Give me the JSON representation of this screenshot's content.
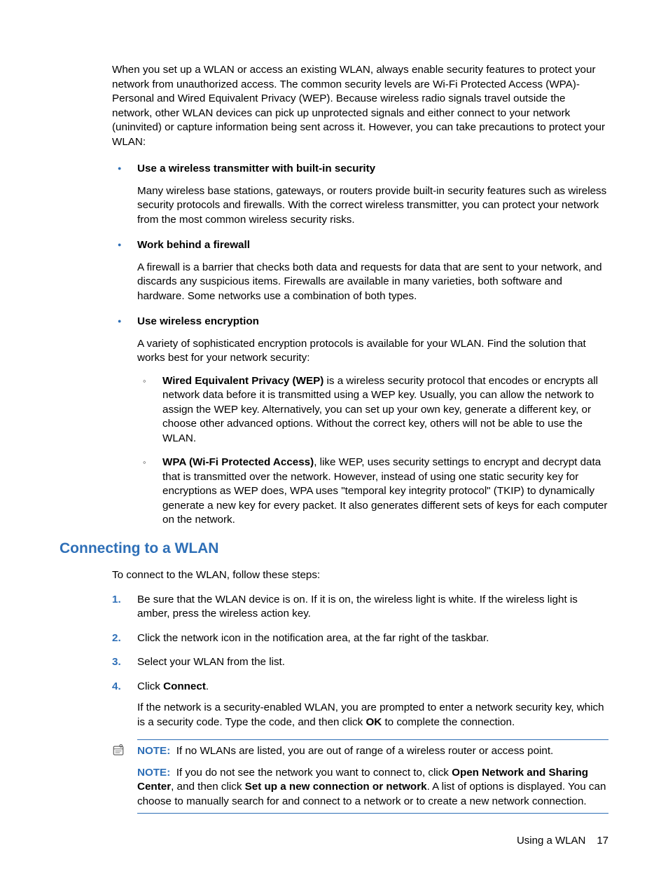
{
  "intro": "When you set up a WLAN or access an existing WLAN, always enable security features to protect your network from unauthorized access. The common security levels are Wi-Fi Protected Access (WPA)-Personal and Wired Equivalent Privacy (WEP). Because wireless radio signals travel outside the network, other WLAN devices can pick up unprotected signals and either connect to your network (uninvited) or capture information being sent across it. However, you can take precautions to protect your WLAN:",
  "bullets": [
    {
      "title": "Use a wireless transmitter with built-in security",
      "body": "Many wireless base stations, gateways, or routers provide built-in security features such as wireless security protocols and firewalls. With the correct wireless transmitter, you can protect your network from the most common wireless security risks."
    },
    {
      "title": "Work behind a firewall",
      "body": "A firewall is a barrier that checks both data and requests for data that are sent to your network, and discards any suspicious items. Firewalls are available in many varieties, both software and hardware. Some networks use a combination of both types."
    },
    {
      "title": "Use wireless encryption",
      "body": "A variety of sophisticated encryption protocols is available for your WLAN. Find the solution that works best for your network security:",
      "sub": [
        {
          "bold": "Wired Equivalent Privacy (WEP)",
          "rest": " is a wireless security protocol that encodes or encrypts all network data before it is transmitted using a WEP key. Usually, you can allow the network to assign the WEP key. Alternatively, you can set up your own key, generate a different key, or choose other advanced options. Without the correct key, others will not be able to use the WLAN."
        },
        {
          "bold": "WPA (Wi-Fi Protected Access)",
          "rest": ", like WEP, uses security settings to encrypt and decrypt data that is transmitted over the network. However, instead of using one static security key for encryptions as WEP does, WPA uses \"temporal key integrity protocol\" (TKIP) to dynamically generate a new key for every packet. It also generates different sets of keys for each computer on the network."
        }
      ]
    }
  ],
  "heading": "Connecting to a WLAN",
  "heading_intro": "To connect to the WLAN, follow these steps:",
  "steps": [
    {
      "num": "1.",
      "text": "Be sure that the WLAN device is on. If it is on, the wireless light is white. If the wireless light is amber, press the wireless action key."
    },
    {
      "num": "2.",
      "text": "Click the network icon in the notification area, at the far right of the taskbar."
    },
    {
      "num": "3.",
      "text": "Select your WLAN from the list."
    },
    {
      "num": "4.",
      "text_pre": "Click ",
      "text_bold1": "Connect",
      "text_post1": ".",
      "followup_pre": "If the network is a security-enabled WLAN, you are prompted to enter a network security key, which is a security code. Type the code, and then click ",
      "followup_bold": "OK",
      "followup_post": " to complete the connection."
    }
  ],
  "notes": {
    "label": "NOTE:",
    "note1": "If no WLANs are listed, you are out of range of a wireless router or access point.",
    "note2_pre": "If you do not see the network you want to connect to, click ",
    "note2_b1": "Open Network and Sharing Center",
    "note2_mid": ", and then click ",
    "note2_b2": "Set up a new connection or network",
    "note2_post": ". A list of options is displayed. You can choose to manually search for and connect to a network or to create a new network connection."
  },
  "footer": {
    "section": "Using a WLAN",
    "page": "17"
  }
}
